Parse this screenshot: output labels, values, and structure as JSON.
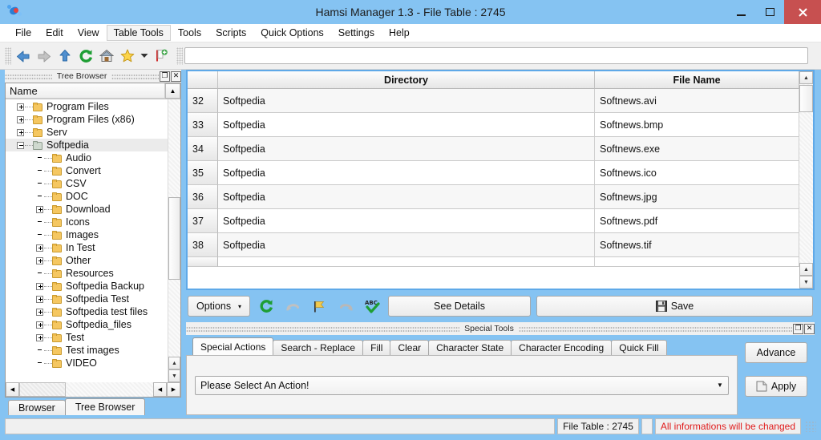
{
  "window": {
    "title": "Hamsi Manager 1.3 - File Table : 2745",
    "app_icon": "hamsi-app-icon",
    "minimize": "–",
    "maximize": "□",
    "close": "✕"
  },
  "menubar": {
    "items": [
      {
        "label": "File",
        "active": false
      },
      {
        "label": "Edit",
        "active": false
      },
      {
        "label": "View",
        "active": false
      },
      {
        "label": "Table Tools",
        "active": true
      },
      {
        "label": "Tools",
        "active": false
      },
      {
        "label": "Scripts",
        "active": false
      },
      {
        "label": "Quick Options",
        "active": false
      },
      {
        "label": "Settings",
        "active": false
      },
      {
        "label": "Help",
        "active": false
      }
    ]
  },
  "toolbar": {
    "icons": [
      {
        "name": "back-arrow-icon"
      },
      {
        "name": "forward-arrow-icon"
      },
      {
        "name": "up-arrow-icon"
      },
      {
        "name": "refresh-icon"
      },
      {
        "name": "home-icon"
      },
      {
        "name": "favorites-star-icon"
      },
      {
        "name": "favorites-dropdown-icon"
      },
      {
        "name": "add-bookmark-icon"
      }
    ],
    "address_value": "",
    "address_placeholder": ""
  },
  "tree_panel": {
    "dock_title": "Tree Browser",
    "dock_float_label": "❐",
    "dock_close_label": "✕",
    "column_header": "Name",
    "items": [
      {
        "label": "Program Files",
        "depth": 1,
        "expander": "plus",
        "open": false
      },
      {
        "label": "Program Files (x86)",
        "depth": 1,
        "expander": "plus",
        "open": false
      },
      {
        "label": "Serv",
        "depth": 1,
        "expander": "plus",
        "open": false
      },
      {
        "label": "Softpedia",
        "depth": 1,
        "expander": "minus",
        "open": true,
        "selected": true
      },
      {
        "label": "Audio",
        "depth": 2,
        "expander": "none",
        "open": false
      },
      {
        "label": "Convert",
        "depth": 2,
        "expander": "none",
        "open": false
      },
      {
        "label": "CSV",
        "depth": 2,
        "expander": "none",
        "open": false
      },
      {
        "label": "DOC",
        "depth": 2,
        "expander": "none",
        "open": false
      },
      {
        "label": "Download",
        "depth": 2,
        "expander": "plus",
        "open": false
      },
      {
        "label": "Icons",
        "depth": 2,
        "expander": "none",
        "open": false
      },
      {
        "label": "Images",
        "depth": 2,
        "expander": "none",
        "open": false
      },
      {
        "label": "In Test",
        "depth": 2,
        "expander": "plus",
        "open": false
      },
      {
        "label": "Other",
        "depth": 2,
        "expander": "plus",
        "open": false
      },
      {
        "label": "Resources",
        "depth": 2,
        "expander": "none",
        "open": false
      },
      {
        "label": "Softpedia Backup",
        "depth": 2,
        "expander": "plus",
        "open": false
      },
      {
        "label": "Softpedia Test",
        "depth": 2,
        "expander": "plus",
        "open": false
      },
      {
        "label": "Softpedia test files",
        "depth": 2,
        "expander": "plus",
        "open": false
      },
      {
        "label": "Softpedia_files",
        "depth": 2,
        "expander": "plus",
        "open": false
      },
      {
        "label": "Test",
        "depth": 2,
        "expander": "plus",
        "open": false
      },
      {
        "label": "Test images",
        "depth": 2,
        "expander": "none",
        "open": false
      },
      {
        "label": "VIDEO",
        "depth": 2,
        "expander": "none",
        "open": false
      }
    ],
    "tabs": [
      {
        "label": "Browser",
        "active": false
      },
      {
        "label": "Tree Browser",
        "active": true
      }
    ]
  },
  "file_table": {
    "columns": [
      "",
      "Directory",
      "File Name"
    ],
    "rows": [
      {
        "index": "32",
        "directory": "Softpedia",
        "file_name": "Softnews.avi"
      },
      {
        "index": "33",
        "directory": "Softpedia",
        "file_name": "Softnews.bmp"
      },
      {
        "index": "34",
        "directory": "Softpedia",
        "file_name": "Softnews.exe"
      },
      {
        "index": "35",
        "directory": "Softpedia",
        "file_name": "Softnews.ico"
      },
      {
        "index": "36",
        "directory": "Softpedia",
        "file_name": "Softnews.jpg"
      },
      {
        "index": "37",
        "directory": "Softpedia",
        "file_name": "Softnews.pdf"
      },
      {
        "index": "38",
        "directory": "Softpedia",
        "file_name": "Softnews.tif"
      }
    ]
  },
  "action_bar": {
    "options_label": "Options",
    "options_arrow": "▾",
    "icons": [
      {
        "name": "refresh-icon"
      },
      {
        "name": "undo-icon"
      },
      {
        "name": "flag-icon"
      },
      {
        "name": "redo-icon"
      },
      {
        "name": "spellcheck-icon"
      }
    ],
    "see_details_label": "See Details",
    "save_label": "Save"
  },
  "special_tools": {
    "dock_title": "Special Tools",
    "dock_float_label": "❐",
    "dock_close_label": "✕",
    "tabs": [
      {
        "label": "Special Actions",
        "active": true
      },
      {
        "label": "Search - Replace",
        "active": false
      },
      {
        "label": "Fill",
        "active": false
      },
      {
        "label": "Clear",
        "active": false
      },
      {
        "label": "Character State",
        "active": false
      },
      {
        "label": "Character Encoding",
        "active": false
      },
      {
        "label": "Quick Fill",
        "active": false
      }
    ],
    "action_combo_value": "Please Select An Action!",
    "combo_arrow": "▼",
    "advance_label": "Advance",
    "apply_label": "Apply"
  },
  "statusbar": {
    "left_text": "",
    "file_table_count": "File Table : 2745",
    "spacer_text": "",
    "warning_text": "All informations will be changed",
    "warning_color": "#e01b1b"
  }
}
